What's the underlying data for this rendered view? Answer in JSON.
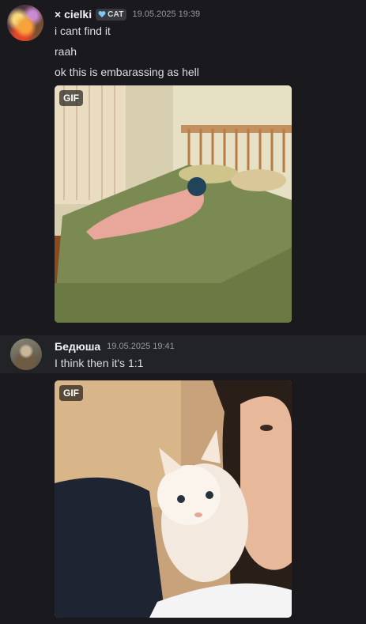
{
  "messages": [
    {
      "author": "× cielki",
      "badge": "CAT",
      "timestamp": "19.05.2025 19:39",
      "lines": [
        "i cant find it",
        "raah",
        "ok this is embarassing as hell"
      ],
      "gif_label": "GIF"
    },
    {
      "author": "Бедюша",
      "timestamp": "19.05.2025 19:41",
      "lines": [
        "I think then it's 1:1"
      ],
      "gif_label": "GIF"
    }
  ],
  "colors": {
    "background": "#1a1a1e",
    "highlight_row": "#222327",
    "username": "#f2f3f5",
    "timestamp": "#949ba4",
    "badge_icon": "#7ec8f5"
  }
}
